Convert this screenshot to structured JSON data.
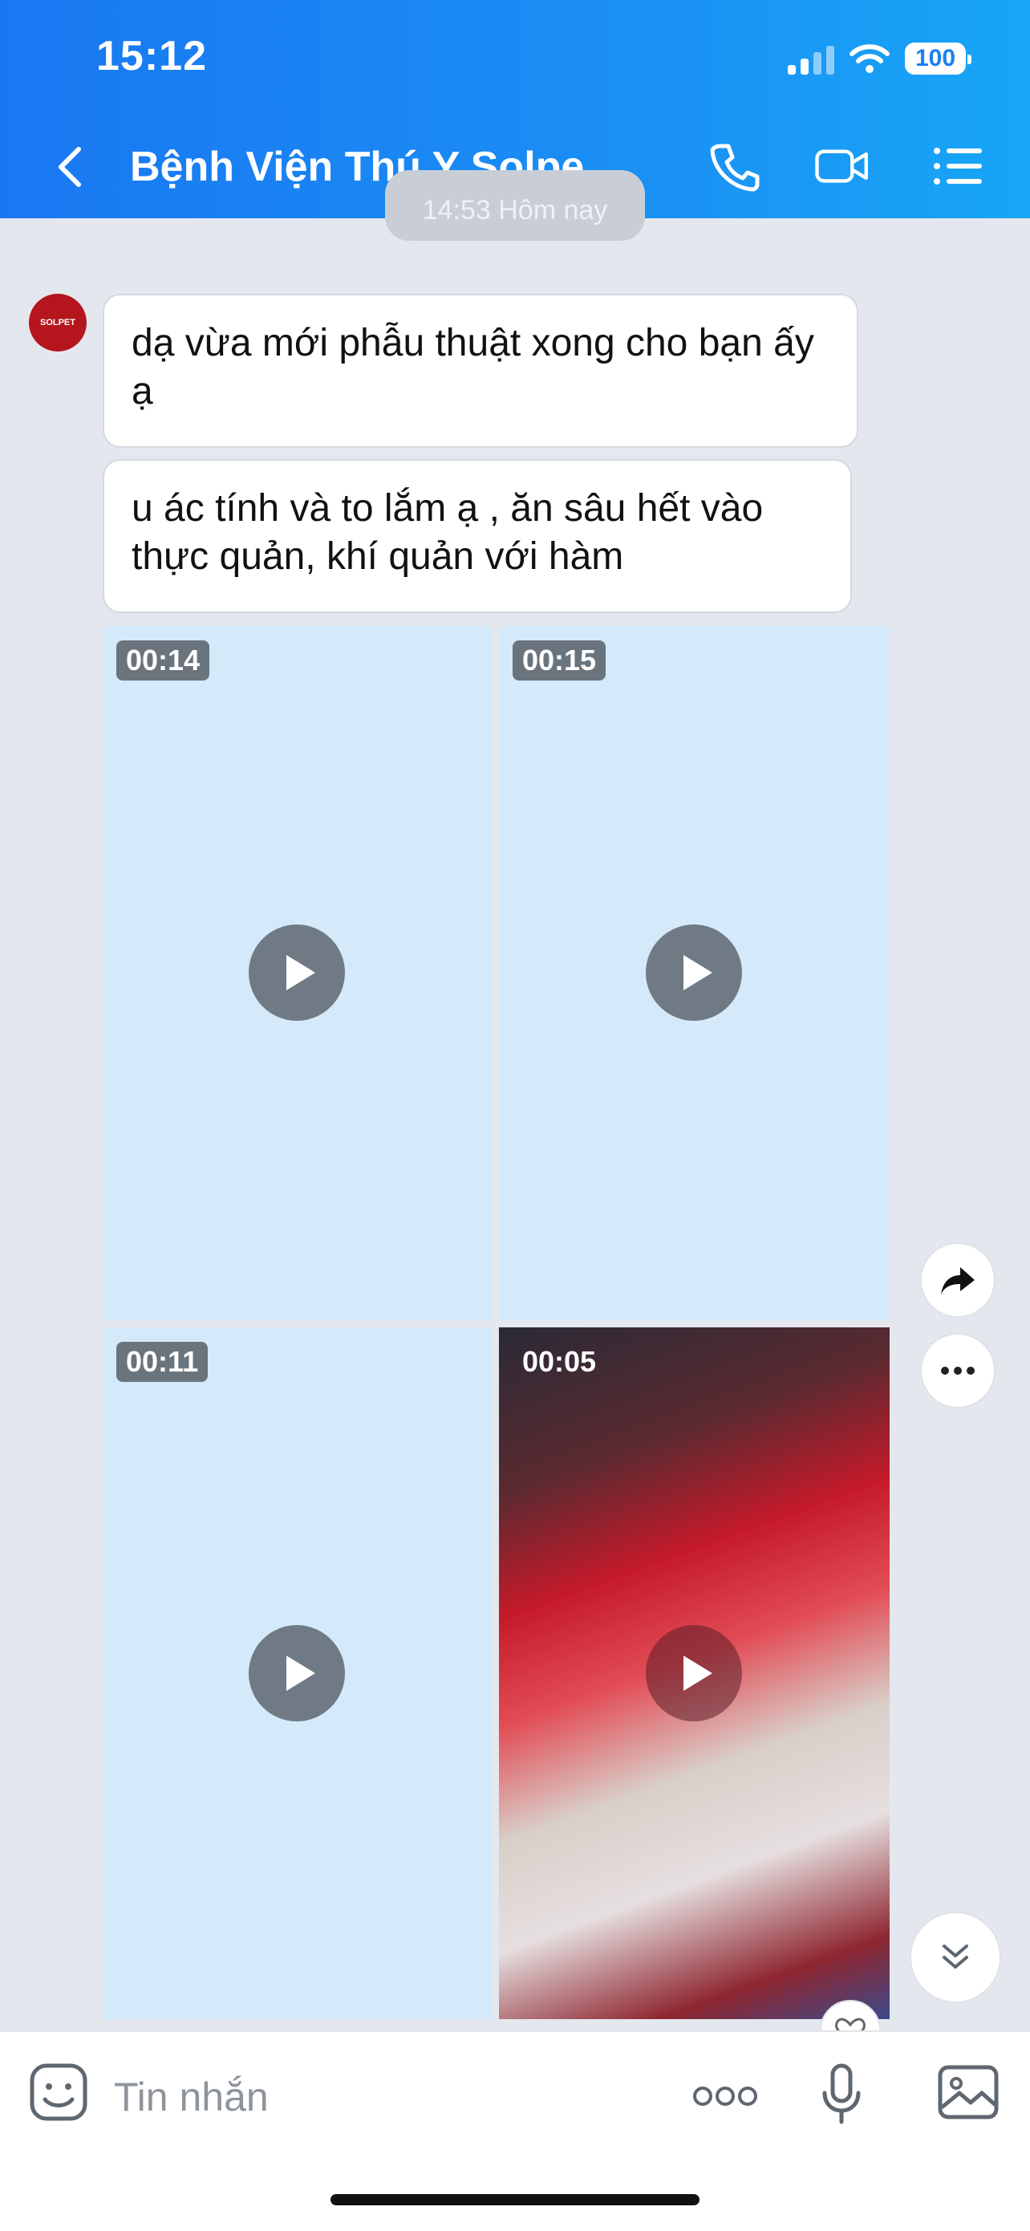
{
  "status": {
    "time": "15:12",
    "battery": "100"
  },
  "header": {
    "title": "Bệnh Viện Thú Y Solpe..."
  },
  "chat": {
    "timestamp": "14:53 Hôm nay",
    "avatar_text": "SOLPET",
    "messages": [
      "dạ vừa mới phẫu thuật xong cho bạn ấy ạ",
      "u ác tính và to lắm ạ , ăn sâu hết vào thực quản, khí quản với hàm"
    ],
    "videos": [
      {
        "duration": "00:14"
      },
      {
        "duration": "00:15"
      },
      {
        "duration": "00:11"
      },
      {
        "duration": "00:05"
      }
    ]
  },
  "composer": {
    "placeholder": "Tin nhắn"
  }
}
